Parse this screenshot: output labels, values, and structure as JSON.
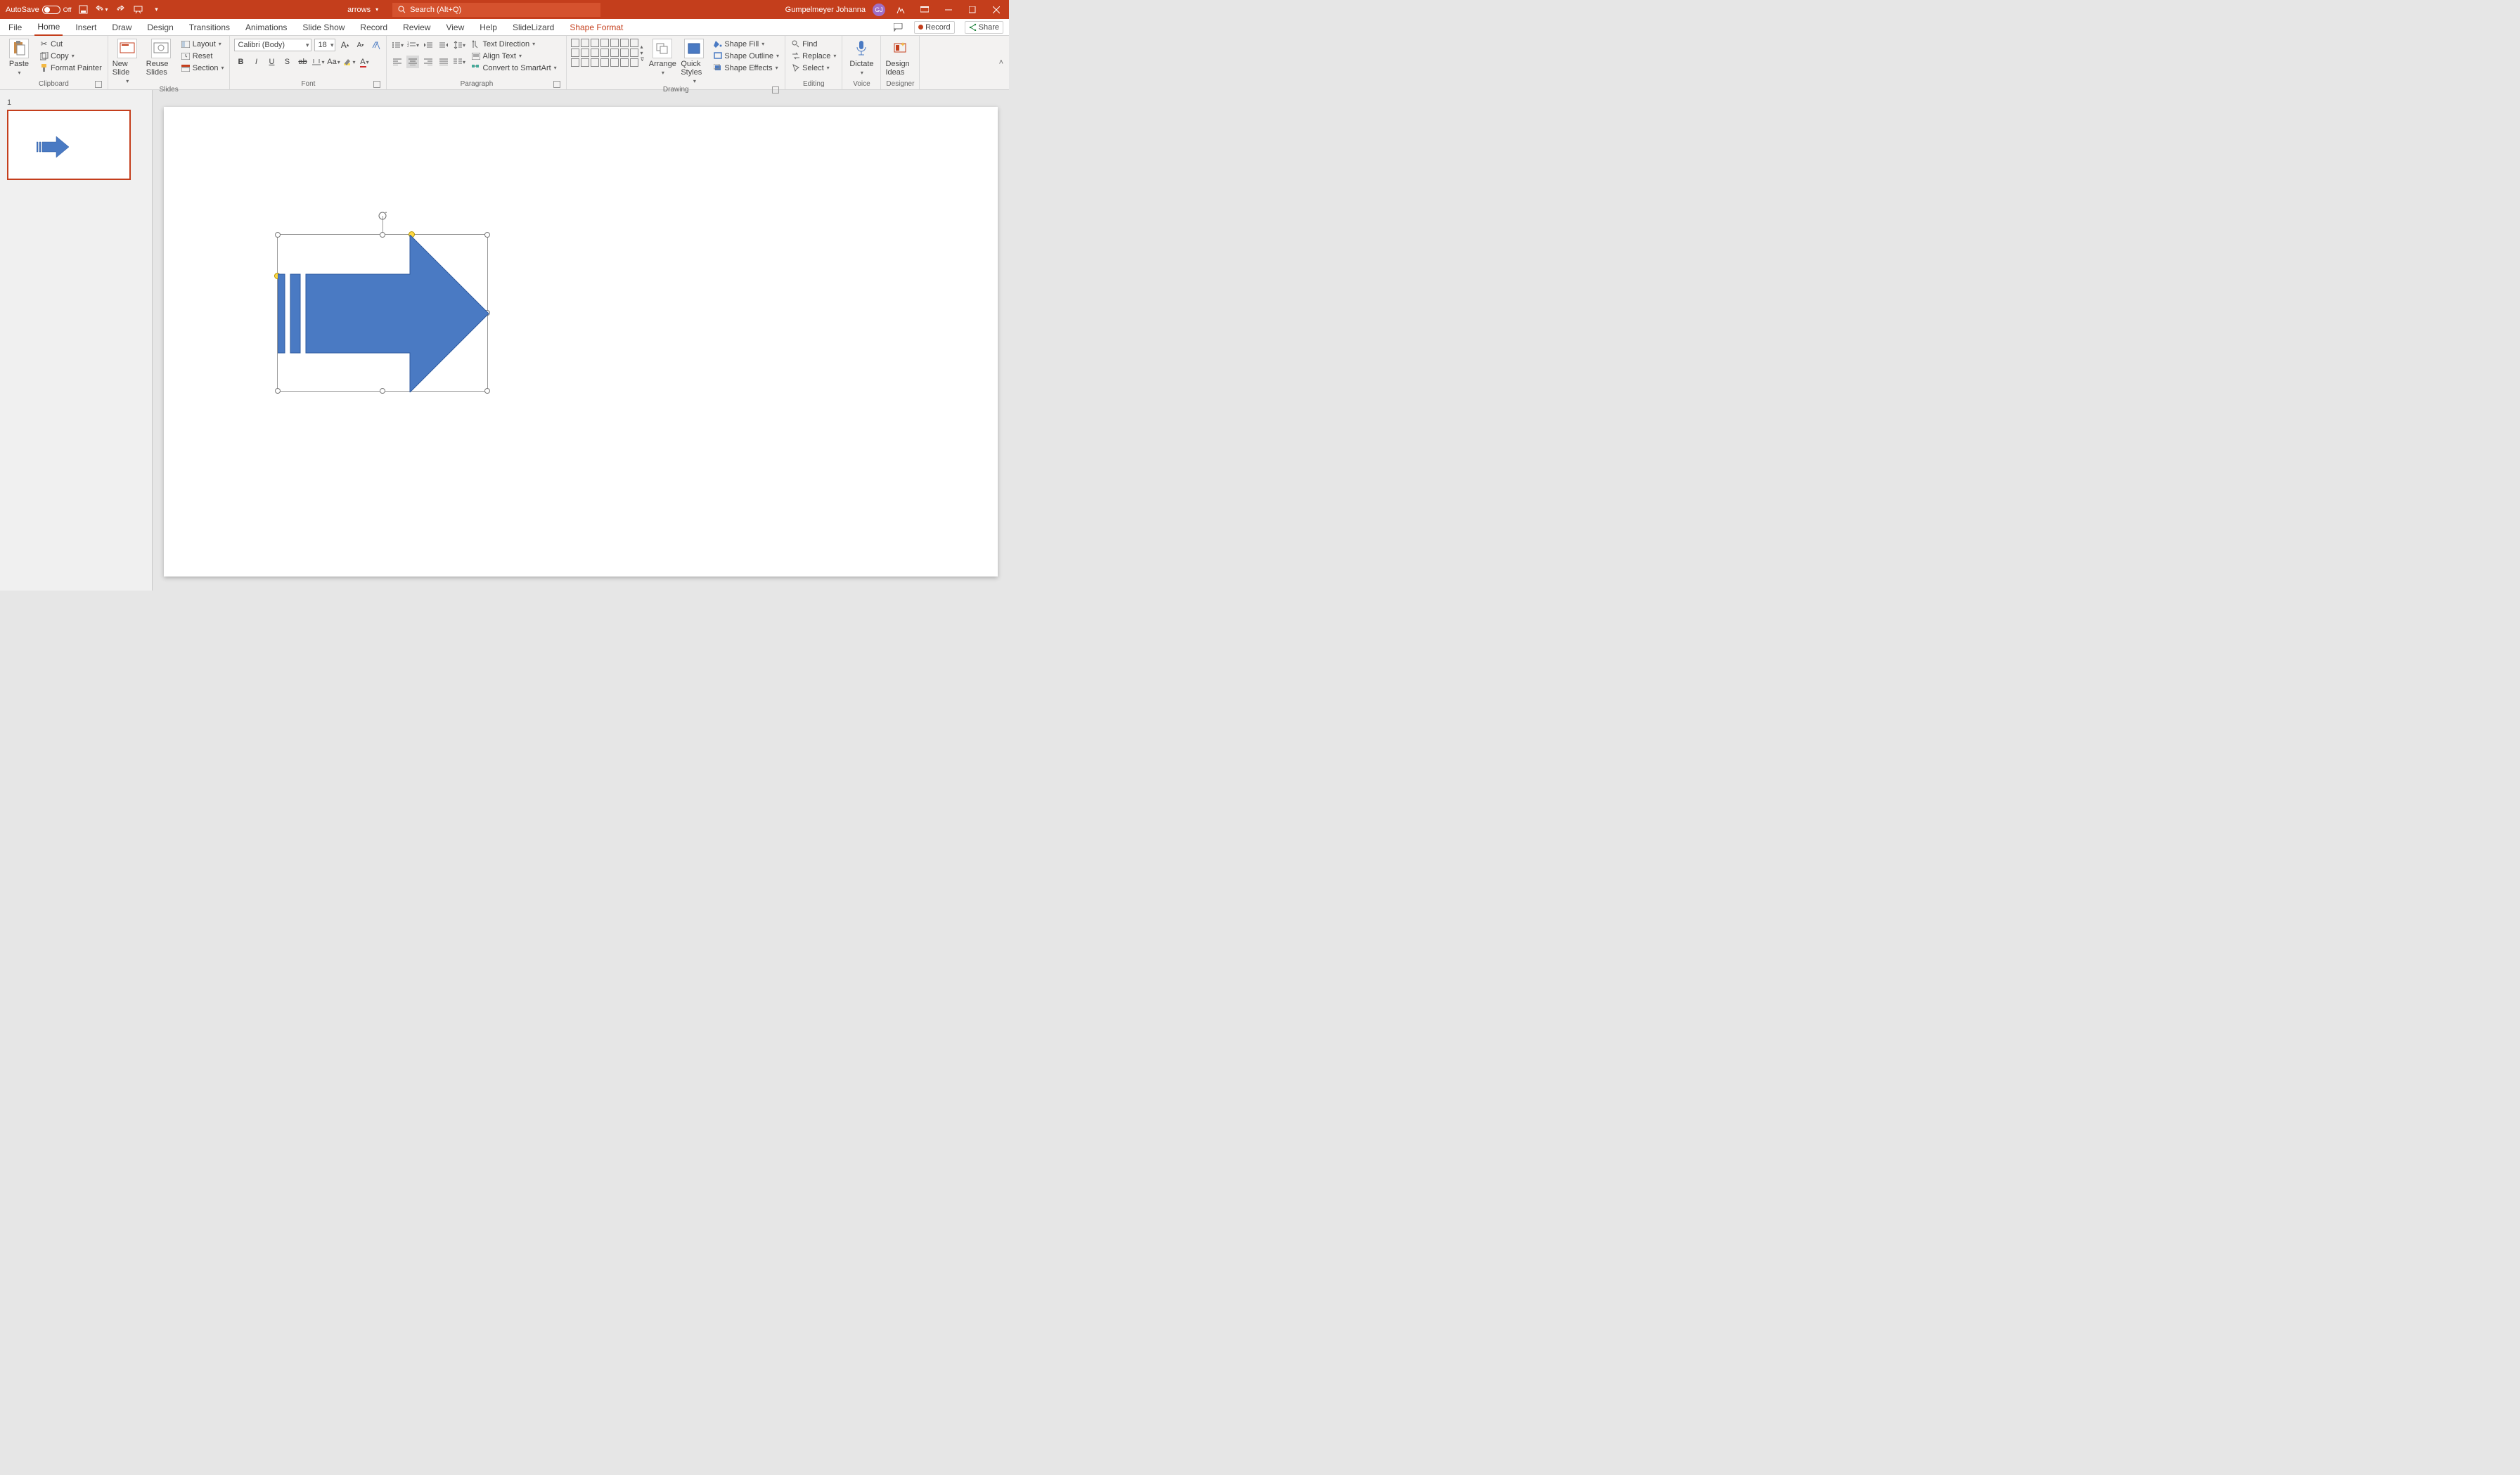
{
  "titlebar": {
    "autosave_label": "AutoSave",
    "autosave_state": "Off",
    "doc_title": "arrows",
    "search_placeholder": "Search (Alt+Q)",
    "user_name": "Gumpelmeyer Johanna",
    "user_initials": "GJ"
  },
  "tabs": {
    "file": "File",
    "home": "Home",
    "insert": "Insert",
    "draw": "Draw",
    "design": "Design",
    "transitions": "Transitions",
    "animations": "Animations",
    "slideshow": "Slide Show",
    "record": "Record",
    "review": "Review",
    "view": "View",
    "help": "Help",
    "slidelizard": "SlideLizard",
    "shape_format": "Shape Format",
    "comments": "",
    "record_btn": "Record",
    "share": "Share"
  },
  "ribbon": {
    "clipboard": {
      "label": "Clipboard",
      "paste": "Paste",
      "cut": "Cut",
      "copy": "Copy",
      "format_painter": "Format Painter"
    },
    "slides": {
      "label": "Slides",
      "new_slide": "New Slide",
      "reuse_slides": "Reuse Slides",
      "layout": "Layout",
      "reset": "Reset",
      "section": "Section"
    },
    "font": {
      "label": "Font",
      "name": "Calibri (Body)",
      "size": "18"
    },
    "paragraph": {
      "label": "Paragraph",
      "text_direction": "Text Direction",
      "align_text": "Align Text",
      "convert_smartart": "Convert to SmartArt"
    },
    "drawing": {
      "label": "Drawing",
      "arrange": "Arrange",
      "quick_styles": "Quick Styles",
      "shape_fill": "Shape Fill",
      "shape_outline": "Shape Outline",
      "shape_effects": "Shape Effects"
    },
    "editing": {
      "label": "Editing",
      "find": "Find",
      "replace": "Replace",
      "select": "Select"
    },
    "voice": {
      "label": "Voice",
      "dictate": "Dictate"
    },
    "designer": {
      "label": "Designer",
      "design_ideas": "Design Ideas"
    }
  },
  "thumb": {
    "slide_number": "1"
  },
  "colors": {
    "accent": "#4a7ac3",
    "brand": "#c43e1c"
  }
}
